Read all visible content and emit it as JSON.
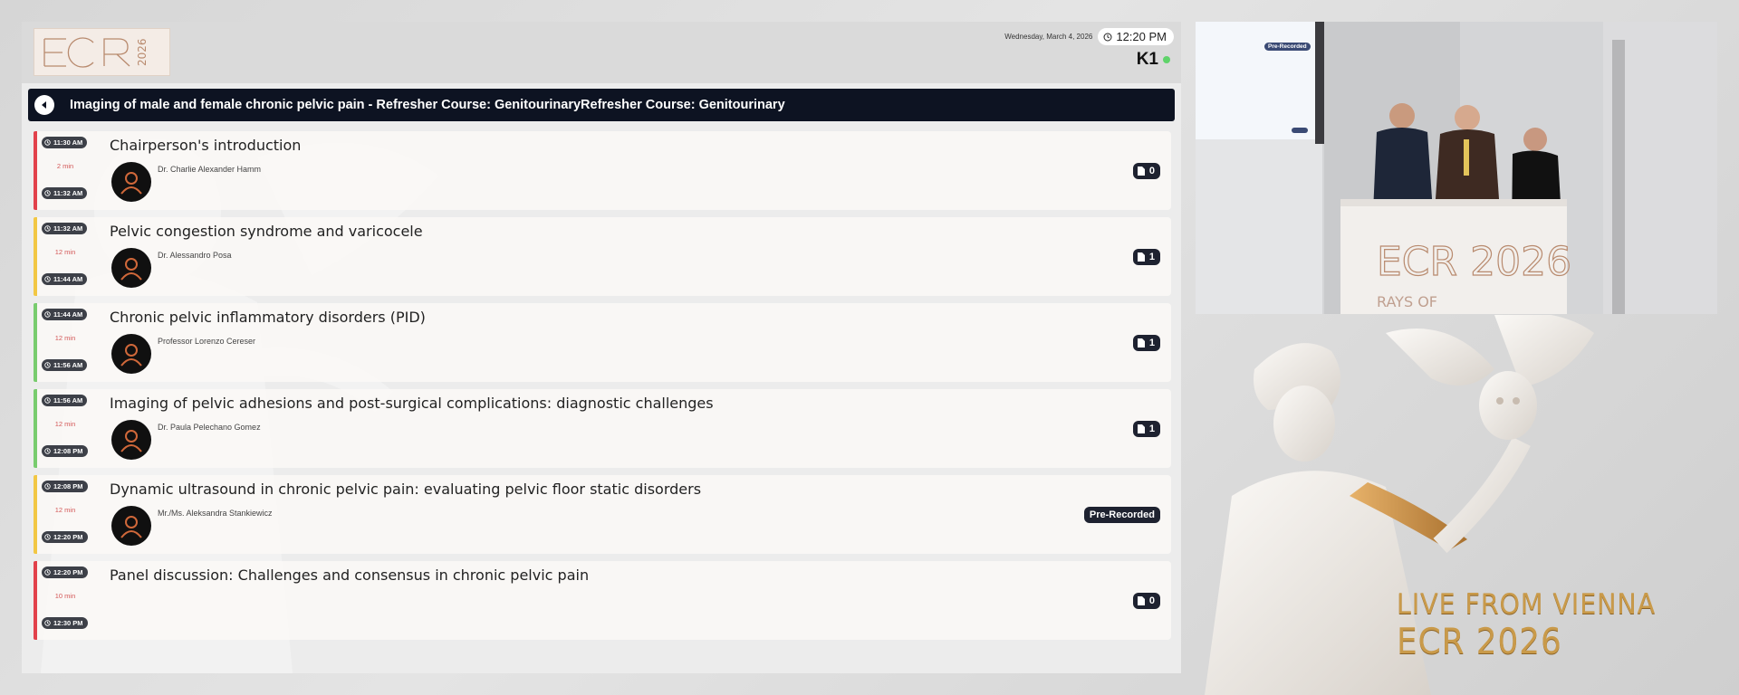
{
  "header": {
    "logo_text": "ECR 2026",
    "date": "Wednesday, March 4, 2026",
    "time": "12:20 PM",
    "room": "K1"
  },
  "session": {
    "title": "Imaging of male and female chronic pelvic pain - Refresher Course: GenitourinaryRefresher Course: Genitourinary"
  },
  "talks": [
    {
      "start": "11:30 AM",
      "duration": "2 min",
      "end": "11:32 AM",
      "title": "Chairperson's introduction",
      "speaker": "Dr. Charlie Alexander Hamm",
      "documents": "0",
      "accent": "#e2414b"
    },
    {
      "start": "11:32 AM",
      "duration": "12 min",
      "end": "11:44 AM",
      "title": "Pelvic congestion syndrome and varicocele",
      "speaker": "Dr. Alessandro Posa",
      "documents": "1",
      "accent": "#f2c744"
    },
    {
      "start": "11:44 AM",
      "duration": "12 min",
      "end": "11:56 AM",
      "title": "Chronic pelvic inflammatory disorders (PID)",
      "speaker": "Professor Lorenzo Cereser",
      "documents": "1",
      "accent": "#78cc6e"
    },
    {
      "start": "11:56 AM",
      "duration": "12 min",
      "end": "12:08 PM",
      "title": "Imaging of pelvic adhesions and post-surgical complications: diagnostic challenges",
      "speaker": "Dr. Paula Pelechano Gomez",
      "documents": "1",
      "accent": "#78cc6e"
    },
    {
      "start": "12:08 PM",
      "duration": "12 min",
      "end": "12:20 PM",
      "title": "Dynamic ultrasound in chronic pelvic pain: evaluating pelvic floor static disorders",
      "speaker": "Mr./Ms. Aleksandra Stankiewicz",
      "badge": "Pre-Recorded",
      "accent": "#f2c744"
    },
    {
      "start": "12:20 PM",
      "duration": "10 min",
      "end": "12:30 PM",
      "title": "Panel discussion: Challenges and consensus in chronic pelvic pain",
      "documents": "0",
      "accent": "#e2414b"
    }
  ],
  "video": {
    "prerecorded_label": "Pre-Recorded",
    "podium_logo": "ECR 2026",
    "podium_text": "RAYS OF"
  },
  "branding": {
    "line1": "LIVE FROM VIENNA",
    "line2": "ECR 2026"
  }
}
